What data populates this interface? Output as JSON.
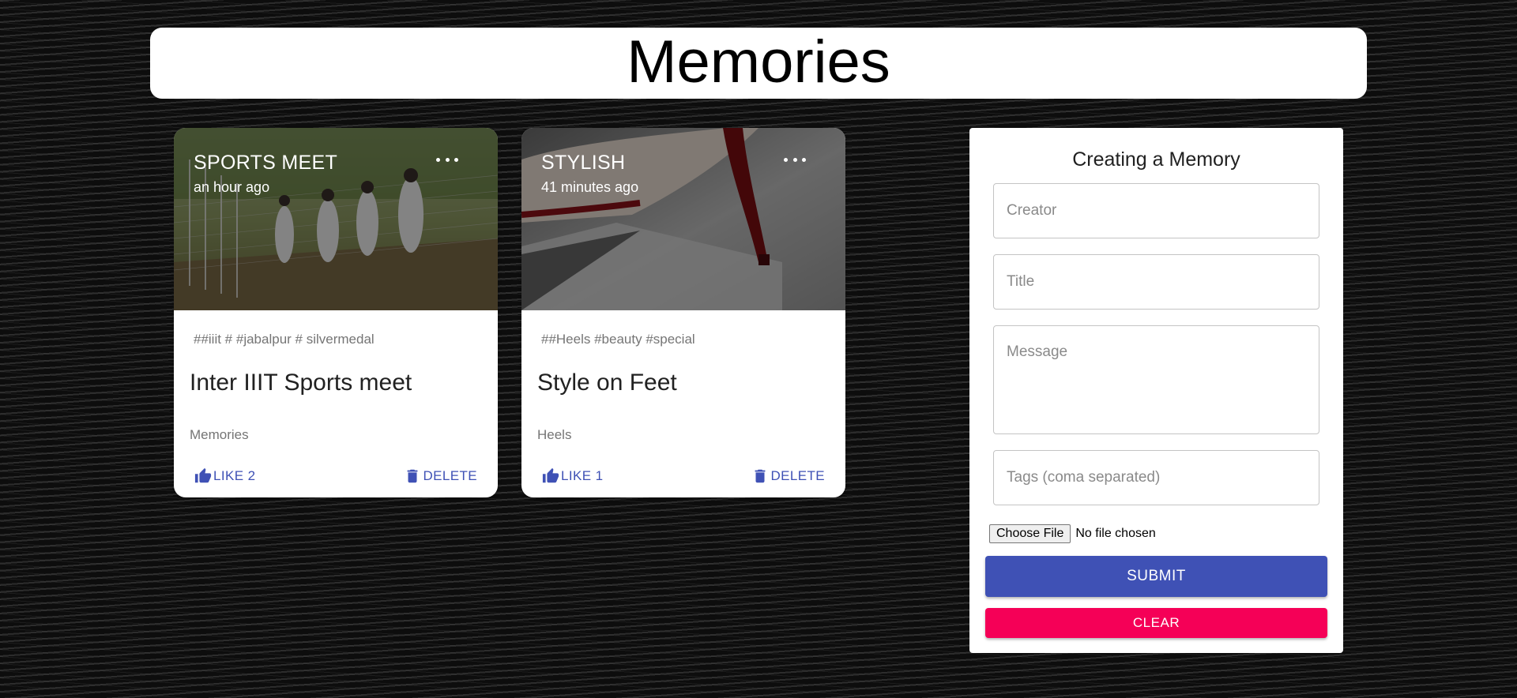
{
  "header": {
    "title": "Memories"
  },
  "posts": [
    {
      "creator": "SPORTS MEET",
      "time": "an hour ago",
      "tags": "##iiit # #jabalpur # silvermedal",
      "title": "Inter IIIT Sports meet",
      "message": "Memories",
      "like_label": "LIKE 2",
      "delete_label": "DELETE",
      "image": "cricket-practice-nets-photo"
    },
    {
      "creator": "STYLISH",
      "time": "41 minutes ago",
      "tags": "##Heels #beauty #special",
      "title": "Style on Feet",
      "message": "Heels",
      "like_label": "LIKE 1",
      "delete_label": "DELETE",
      "image": "red-high-heel-photo"
    }
  ],
  "form": {
    "heading": "Creating a Memory",
    "creator_placeholder": "Creator",
    "title_placeholder": "Title",
    "message_placeholder": "Message",
    "tags_placeholder": "Tags (coma separated)",
    "file_button": "Choose File",
    "file_status": "No file chosen",
    "submit_label": "SUBMIT",
    "clear_label": "CLEAR"
  },
  "colors": {
    "primary": "#3f51b5",
    "secondary": "#f50057",
    "background": "#0d0d0d"
  },
  "icons": {
    "like": "thumb-up-icon",
    "delete": "trash-icon",
    "more": "more-horizontal-icon"
  }
}
